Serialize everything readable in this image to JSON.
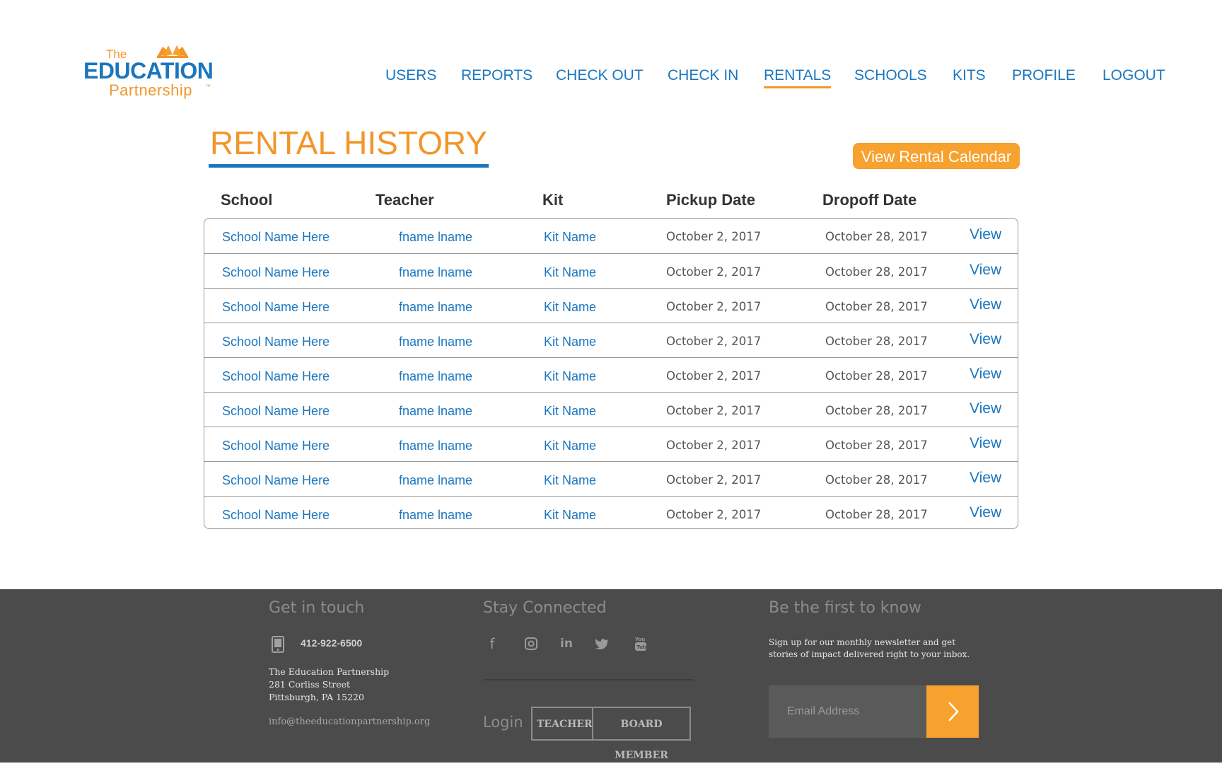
{
  "brand": {
    "logo_the": "The",
    "logo_education": "EDUCATION",
    "logo_partnership": "Partnership",
    "logo_tm": "™",
    "accent_orange": "#f2962a",
    "accent_blue": "#1b76be"
  },
  "nav": {
    "items": [
      {
        "label": "USERS",
        "active": false
      },
      {
        "label": "REPORTS",
        "active": false
      },
      {
        "label": "CHECK OUT",
        "active": false
      },
      {
        "label": "CHECK IN",
        "active": false
      },
      {
        "label": "RENTALS",
        "active": true
      },
      {
        "label": "SCHOOLS",
        "active": false
      },
      {
        "label": "KITS",
        "active": false
      },
      {
        "label": "PROFILE",
        "active": false
      },
      {
        "label": "LOGOUT",
        "active": false
      }
    ]
  },
  "page": {
    "title": "RENTAL HISTORY",
    "calendar_button": "View Rental Calendar"
  },
  "table": {
    "headers": [
      "School",
      "Teacher",
      "Kit",
      "Pickup Date",
      "Dropoff Date"
    ],
    "rows": [
      {
        "school": "School Name Here",
        "teacher": "fname lname",
        "kit": "Kit Name",
        "pickup": "October 2, 2017",
        "dropoff": "October 28, 2017",
        "action": "View"
      },
      {
        "school": "School Name Here",
        "teacher": "fname lname",
        "kit": "Kit Name",
        "pickup": "October 2, 2017",
        "dropoff": "October 28, 2017",
        "action": "View"
      },
      {
        "school": "School Name Here",
        "teacher": "fname lname",
        "kit": "Kit Name",
        "pickup": "October 2, 2017",
        "dropoff": "October 28, 2017",
        "action": "View"
      },
      {
        "school": "School Name Here",
        "teacher": "fname lname",
        "kit": "Kit Name",
        "pickup": "October 2, 2017",
        "dropoff": "October 28, 2017",
        "action": "View"
      },
      {
        "school": "School Name Here",
        "teacher": "fname lname",
        "kit": "Kit Name",
        "pickup": "October 2, 2017",
        "dropoff": "October 28, 2017",
        "action": "View"
      },
      {
        "school": "School Name Here",
        "teacher": "fname lname",
        "kit": "Kit Name",
        "pickup": "October 2, 2017",
        "dropoff": "October 28, 2017",
        "action": "View"
      },
      {
        "school": "School Name Here",
        "teacher": "fname lname",
        "kit": "Kit Name",
        "pickup": "October 2, 2017",
        "dropoff": "October 28, 2017",
        "action": "View"
      },
      {
        "school": "School Name Here",
        "teacher": "fname lname",
        "kit": "Kit Name",
        "pickup": "October 2, 2017",
        "dropoff": "October 28, 2017",
        "action": "View"
      },
      {
        "school": "School Name Here",
        "teacher": "fname lname",
        "kit": "Kit Name",
        "pickup": "October 2, 2017",
        "dropoff": "October 28, 2017",
        "action": "View"
      }
    ]
  },
  "footer": {
    "contact": {
      "heading": "Get in touch",
      "phone": "412-922-6500",
      "address_line1": "The Education Partnership",
      "address_line2": "281 Corliss Street",
      "address_line3": "Pittsburgh, PA 15220",
      "email": "info@theeducationpartnership.org"
    },
    "social": {
      "heading": "Stay Connected",
      "icons": [
        "facebook-icon",
        "instagram-icon",
        "linkedin-icon",
        "twitter-icon",
        "youtube-icon"
      ],
      "login_label": "Login",
      "teacher_button": "TEACHER",
      "board_button": "BOARD MEMBER"
    },
    "newsletter": {
      "heading": "Be the first to know",
      "text_line1": "Sign up for our monthly newsletter and get",
      "text_line2": "stories of impact delivered right to your inbox.",
      "email_placeholder": "Email Address"
    }
  }
}
